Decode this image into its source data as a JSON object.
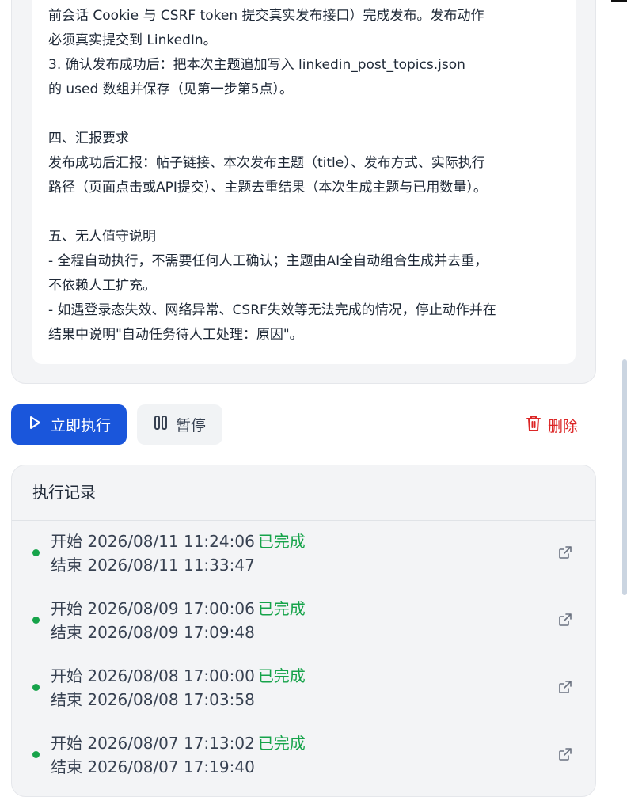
{
  "prompt": {
    "lines": [
      "前会话 Cookie 与 CSRF token 提交真实发布接口）完成发布。发布动作",
      "必须真实提交到 LinkedIn。",
      "3. 确认发布成功后：把本次主题追加写入 linkedin_post_topics.json",
      "的 used 数组并保存（见第一步第5点）。",
      "",
      "四、汇报要求",
      "发布成功后汇报：帖子链接、本次发布主题（title）、发布方式、实际执行",
      "路径（页面点击或API提交）、主题去重结果（本次生成主题与已用数量）。",
      "",
      "五、无人值守说明",
      "- 全程自动执行，不需要任何人工确认；主题由AI全自动组合生成并去重，",
      "不依赖人工扩充。",
      "- 如遇登录态失效、网络异常、CSRF失效等无法完成的情况，停止动作并在",
      "结果中说明\"自动任务待人工处理：原因\"。"
    ]
  },
  "actions": {
    "run_label": "立即执行",
    "pause_label": "暂停",
    "delete_label": "删除"
  },
  "log": {
    "title": "执行记录",
    "rows": [
      {
        "start": "开始 2026/08/11 11:24:06",
        "status": "已完成",
        "end": "结束 2026/08/11 11:33:47"
      },
      {
        "start": "开始 2026/08/09 17:00:06",
        "status": "已完成",
        "end": "结束 2026/08/09 17:09:48"
      },
      {
        "start": "开始 2026/08/08 17:00:00",
        "status": "已完成",
        "end": "结束 2026/08/08 17:03:58"
      },
      {
        "start": "开始 2026/08/07 17:13:02",
        "status": "已完成",
        "end": "结束 2026/08/07 17:19:40"
      }
    ]
  },
  "colors": {
    "primary": "#1a56db",
    "danger": "#dc2626",
    "success": "#16a34a"
  }
}
